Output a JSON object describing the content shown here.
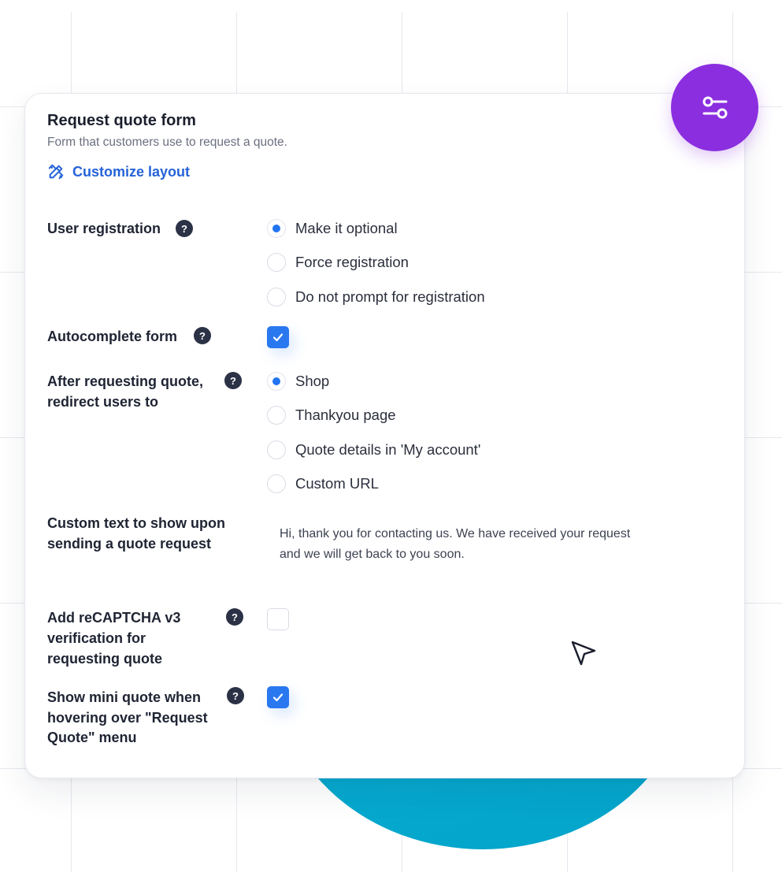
{
  "form": {
    "title": "Request quote form",
    "subtitle": "Form that customers use to request a quote.",
    "customize_label": "Customize layout"
  },
  "settings": {
    "user_registration": {
      "label": "User registration",
      "options": [
        "Make it optional",
        "Force registration",
        "Do not prompt for registration"
      ],
      "selected": "Make it optional"
    },
    "autocomplete": {
      "label": "Autocomplete form",
      "checked": true
    },
    "redirect": {
      "label_line1": "After requesting quote,",
      "label_line2": "redirect users to",
      "options": [
        "Shop",
        "Thankyou page",
        "Quote details in 'My account'",
        "Custom URL"
      ],
      "selected": "Shop"
    },
    "custom_text": {
      "label_line1": "Custom text to show upon",
      "label_line2": "sending a quote request",
      "value": "Hi, thank you for contacting us. We have received your request and we will get back to you soon."
    },
    "recaptcha": {
      "label_line1": "Add reCAPTCHA v3",
      "label_line2": "verification for",
      "label_line3": "requesting quote",
      "checked": false
    },
    "mini_quote": {
      "label_line1": "Show mini quote when",
      "label_line2": "hovering over \"Request",
      "label_line3": "Quote\" menu",
      "checked": true
    }
  },
  "help_glyph": "?",
  "icons": {
    "fab": "sliders-icon",
    "customize": "pencil-ruler-icon",
    "cursor": "pointer-arrow-icon",
    "check": "checkmark-icon"
  },
  "colors": {
    "accent_blue": "#2a78f0",
    "link_blue": "#2563d9",
    "fab_purple": "#8b2ee0",
    "circle_teal": "#06a9cf"
  }
}
